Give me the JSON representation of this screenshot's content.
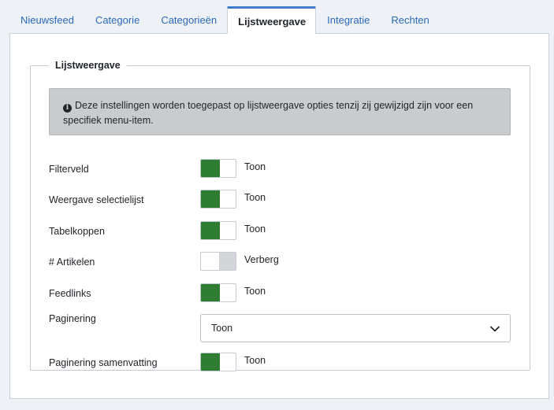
{
  "tabs": [
    {
      "label": "Nieuwsfeed",
      "active": false
    },
    {
      "label": "Categorie",
      "active": false
    },
    {
      "label": "Categorieën",
      "active": false
    },
    {
      "label": "Lijstweergave",
      "active": true
    },
    {
      "label": "Integratie",
      "active": false
    },
    {
      "label": "Rechten",
      "active": false
    }
  ],
  "fieldset": {
    "legend": "Lijstweergave",
    "alert": "Deze instellingen worden toegepast op lijstweergave opties tenzij zij gewijzigd zijn voor een specifiek menu-item.",
    "alert_icon": "info-icon"
  },
  "options": [
    {
      "label": "Filterveld",
      "state": "Toon",
      "on": true
    },
    {
      "label": "Weergave selectielijst",
      "state": "Toon",
      "on": true
    },
    {
      "label": "Tabelkoppen",
      "state": "Toon",
      "on": true
    },
    {
      "label": "# Artikelen",
      "state": "Verberg",
      "on": false
    },
    {
      "label": "Feedlinks",
      "state": "Toon",
      "on": true
    }
  ],
  "paginering": {
    "label": "Paginering",
    "value": "Toon"
  },
  "paginering_samenvatting": {
    "label": "Paginering samenvatting",
    "state": "Toon",
    "on": true
  },
  "colors": {
    "switch_on": "#2e7d32",
    "switch_off": "#d3d5d8",
    "tab_accent": "#3d7cc9"
  }
}
